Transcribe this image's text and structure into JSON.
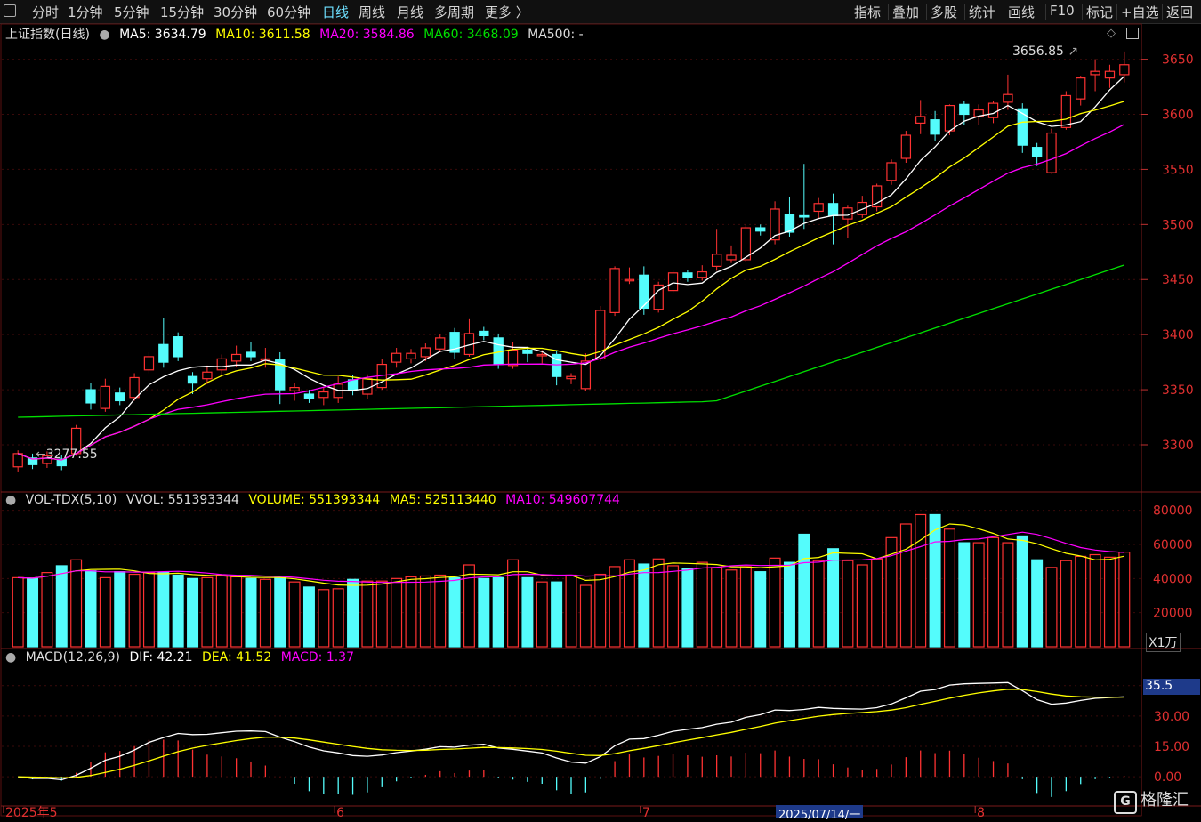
{
  "toolbar": {
    "periods": [
      "分时",
      "1分钟",
      "5分钟",
      "15分钟",
      "30分钟",
      "60分钟",
      "日线",
      "周线",
      "月线",
      "多周期",
      "更多 〉"
    ],
    "active_period": "日线",
    "tools": [
      "指标",
      "叠加",
      "多股",
      "统计",
      "画线",
      "F10",
      "标记",
      "+自选",
      "返回"
    ]
  },
  "main_legend": {
    "name": "上证指数(日线)",
    "ma5": "MA5: 3634.79",
    "ma10": "MA10: 3611.58",
    "ma20": "MA20: 3584.86",
    "ma60": "MA60: 3468.09",
    "ma500": "MA500: -"
  },
  "vol_legend": {
    "name": "VOL-TDX(5,10)",
    "vvol": "VVOL: 551393344",
    "volume": "VOLUME: 551393344",
    "ma5": "MA5: 525113440",
    "ma10": "MA10: 549607744"
  },
  "macd_legend": {
    "name": "MACD(12,26,9)",
    "dif": "DIF: 42.21",
    "dea": "DEA: 41.52",
    "macd": "MACD: 1.37"
  },
  "price_axis": [
    "3650",
    "3600",
    "3550",
    "3500",
    "3450",
    "3400",
    "3350",
    "3300"
  ],
  "vol_axis": [
    "80000",
    "60000",
    "40000",
    "20000"
  ],
  "vol_unit": "X1万",
  "macd_axis": [
    "45.00",
    "30.00",
    "15.00",
    "0.00"
  ],
  "macd_marker": "35.5",
  "annotations": {
    "high": "3656.85",
    "low": "3277.55"
  },
  "date_labels": [
    "2025年5",
    "6",
    "7",
    "8"
  ],
  "cursor_date": "2025/07/14/一",
  "watermark": "格隆汇",
  "colors": {
    "up": "#ff3232",
    "down": "#54fcfc",
    "ma5": "#ffffff",
    "ma10": "#ffff00",
    "ma20": "#ff00ff",
    "ma60": "#00e000",
    "grid": "#5a1010"
  },
  "chart_data": {
    "type": "candlestick",
    "ohlc": [
      [
        3280,
        3292,
        3275,
        3295
      ],
      [
        3288,
        3282,
        3278,
        3292
      ],
      [
        3283,
        3290,
        3279,
        3294
      ],
      [
        3287,
        3281,
        3277,
        3291
      ],
      [
        3292,
        3315,
        3290,
        3318
      ],
      [
        3350,
        3338,
        3332,
        3356
      ],
      [
        3333,
        3353,
        3330,
        3360
      ],
      [
        3347,
        3340,
        3336,
        3352
      ],
      [
        3343,
        3361,
        3340,
        3365
      ],
      [
        3368,
        3380,
        3365,
        3384
      ],
      [
        3391,
        3375,
        3370,
        3415
      ],
      [
        3398,
        3380,
        3376,
        3402
      ],
      [
        3362,
        3356,
        3346,
        3366
      ],
      [
        3360,
        3366,
        3355,
        3372
      ],
      [
        3368,
        3378,
        3362,
        3382
      ],
      [
        3376,
        3382,
        3371,
        3390
      ],
      [
        3384,
        3380,
        3376,
        3393
      ],
      [
        3378,
        3378,
        3370,
        3388
      ],
      [
        3377,
        3350,
        3337,
        3384
      ],
      [
        3349,
        3352,
        3340,
        3356
      ],
      [
        3346,
        3342,
        3338,
        3350
      ],
      [
        3343,
        3348,
        3336,
        3352
      ],
      [
        3343,
        3355,
        3338,
        3362
      ],
      [
        3359,
        3350,
        3345,
        3363
      ],
      [
        3346,
        3360,
        3342,
        3364
      ],
      [
        3352,
        3373,
        3350,
        3378
      ],
      [
        3375,
        3383,
        3370,
        3388
      ],
      [
        3378,
        3383,
        3374,
        3387
      ],
      [
        3380,
        3388,
        3376,
        3392
      ],
      [
        3387,
        3397,
        3384,
        3400
      ],
      [
        3402,
        3384,
        3378,
        3406
      ],
      [
        3382,
        3401,
        3380,
        3414
      ],
      [
        3403,
        3399,
        3395,
        3407
      ],
      [
        3397,
        3373,
        3369,
        3401
      ],
      [
        3372,
        3386,
        3369,
        3393
      ],
      [
        3386,
        3383,
        3375,
        3389
      ],
      [
        3381,
        3382,
        3374,
        3386
      ],
      [
        3382,
        3362,
        3354,
        3386
      ],
      [
        3360,
        3362,
        3355,
        3365
      ],
      [
        3351,
        3376,
        3349,
        3383
      ],
      [
        3378,
        3422,
        3376,
        3426
      ],
      [
        3420,
        3460,
        3417,
        3462
      ],
      [
        3450,
        3450,
        3446,
        3461
      ],
      [
        3454,
        3424,
        3418,
        3462
      ],
      [
        3423,
        3445,
        3420,
        3448
      ],
      [
        3440,
        3456,
        3438,
        3459
      ],
      [
        3456,
        3452,
        3448,
        3459
      ],
      [
        3452,
        3457,
        3449,
        3463
      ],
      [
        3462,
        3473,
        3458,
        3496
      ],
      [
        3468,
        3472,
        3465,
        3481
      ],
      [
        3468,
        3497,
        3466,
        3500
      ],
      [
        3497,
        3494,
        3490,
        3500
      ],
      [
        3486,
        3514,
        3482,
        3521
      ],
      [
        3509,
        3493,
        3489,
        3525
      ],
      [
        3508,
        3507,
        3496,
        3555
      ],
      [
        3512,
        3519,
        3505,
        3524
      ],
      [
        3519,
        3508,
        3482,
        3528
      ],
      [
        3505,
        3515,
        3488,
        3517
      ],
      [
        3509,
        3520,
        3506,
        3526
      ],
      [
        3516,
        3535,
        3512,
        3537
      ],
      [
        3540,
        3556,
        3536,
        3559
      ],
      [
        3560,
        3581,
        3556,
        3585
      ],
      [
        3592,
        3598,
        3582,
        3613
      ],
      [
        3595,
        3582,
        3576,
        3603
      ],
      [
        3585,
        3608,
        3581,
        3609
      ],
      [
        3609,
        3600,
        3590,
        3612
      ],
      [
        3598,
        3604,
        3590,
        3609
      ],
      [
        3597,
        3610,
        3592,
        3612
      ],
      [
        3611,
        3618,
        3604,
        3636
      ],
      [
        3605,
        3572,
        3565,
        3610
      ],
      [
        3570,
        3562,
        3553,
        3574
      ],
      [
        3547,
        3583,
        3546,
        3587
      ],
      [
        3588,
        3617,
        3586,
        3621
      ],
      [
        3614,
        3633,
        3608,
        3635
      ],
      [
        3636,
        3639,
        3621,
        3650
      ],
      [
        3633,
        3639,
        3624,
        3645
      ],
      [
        3636,
        3645,
        3629,
        3657
      ]
    ],
    "volume": [
      40500,
      40000,
      43500,
      47500,
      51000,
      44500,
      40500,
      44000,
      42500,
      43500,
      43500,
      42000,
      40000,
      40500,
      42000,
      41000,
      40000,
      39500,
      40500,
      38000,
      35000,
      33500,
      34000,
      39500,
      38500,
      38500,
      40000,
      41000,
      41500,
      42000,
      40500,
      48000,
      40000,
      40500,
      51000,
      40500,
      38000,
      38000,
      42000,
      36000,
      42500,
      47000,
      51000,
      48500,
      51500,
      47500,
      46000,
      49500,
      46500,
      45000,
      47000,
      44000,
      52000,
      49500,
      66000,
      50500,
      57500,
      50500,
      48000,
      51500,
      64000,
      72000,
      77500,
      77500,
      69000,
      61000,
      61000,
      64000,
      61000,
      65000,
      51000,
      46500,
      50500,
      53000,
      54000,
      52500,
      55500
    ],
    "x": "trading days, 2025-05 to 2025-08"
  }
}
